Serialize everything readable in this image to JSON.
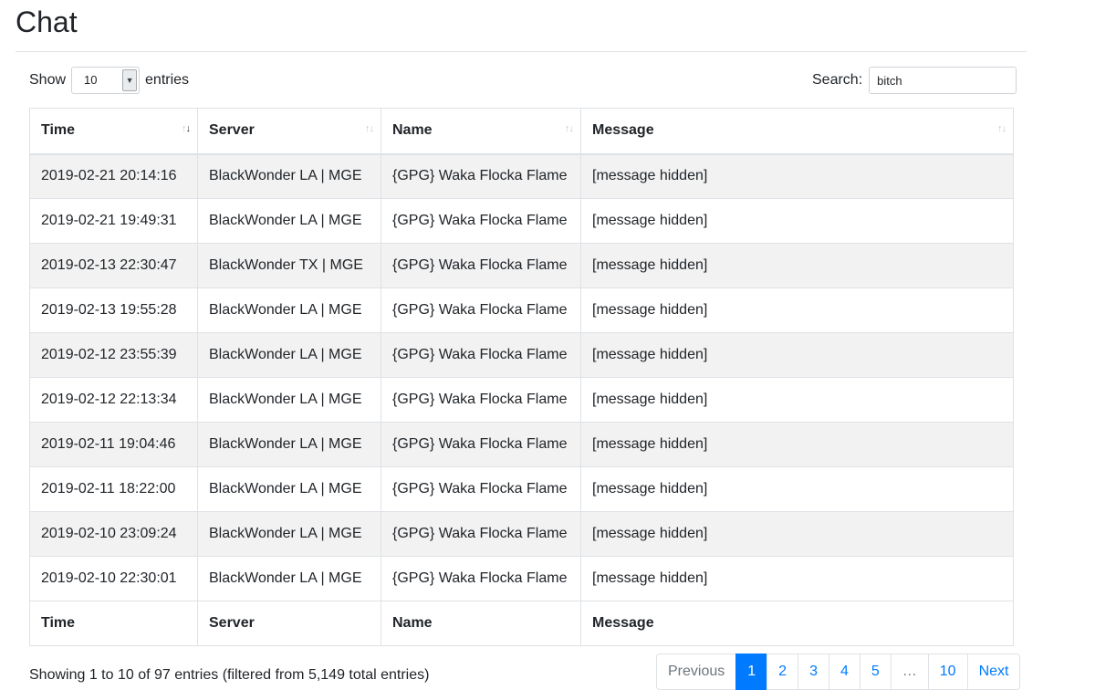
{
  "page": {
    "title": "Chat"
  },
  "controls": {
    "length_prefix": "Show",
    "length_value": "10",
    "length_suffix": "entries",
    "search_label": "Search:",
    "search_value": "bitch"
  },
  "table": {
    "columns": [
      "Time",
      "Server",
      "Name",
      "Message"
    ],
    "rows": [
      [
        "2019-02-21 20:14:16",
        "BlackWonder LA | MGE",
        "{GPG} Waka Flocka Flame",
        "[message hidden]"
      ],
      [
        "2019-02-21 19:49:31",
        "BlackWonder LA | MGE",
        "{GPG} Waka Flocka Flame",
        "[message hidden]"
      ],
      [
        "2019-02-13 22:30:47",
        "BlackWonder TX | MGE",
        "{GPG} Waka Flocka Flame",
        "[message hidden]"
      ],
      [
        "2019-02-13 19:55:28",
        "BlackWonder LA | MGE",
        "{GPG} Waka Flocka Flame",
        "[message hidden]"
      ],
      [
        "2019-02-12 23:55:39",
        "BlackWonder LA | MGE",
        "{GPG} Waka Flocka Flame",
        "[message hidden]"
      ],
      [
        "2019-02-12 22:13:34",
        "BlackWonder LA | MGE",
        "{GPG} Waka Flocka Flame",
        "[message hidden]"
      ],
      [
        "2019-02-11 19:04:46",
        "BlackWonder LA | MGE",
        "{GPG} Waka Flocka Flame",
        "[message hidden]"
      ],
      [
        "2019-02-11 18:22:00",
        "BlackWonder LA | MGE",
        "{GPG} Waka Flocka Flame",
        "[message hidden]"
      ],
      [
        "2019-02-10 23:09:24",
        "BlackWonder LA | MGE",
        "{GPG} Waka Flocka Flame",
        "[message hidden]"
      ],
      [
        "2019-02-10 22:30:01",
        "BlackWonder LA | MGE",
        "{GPG} Waka Flocka Flame",
        "[message hidden]"
      ]
    ]
  },
  "footer": {
    "info": "Showing 1 to 10 of 97 entries (filtered from 5,149 total entries)",
    "pagination": {
      "previous": "Previous",
      "pages": [
        "1",
        "2",
        "3",
        "4",
        "5",
        "…",
        "10"
      ],
      "current": "1",
      "next": "Next"
    }
  },
  "colors": {
    "accent": "#007bff",
    "stripe": "#f2f2f2",
    "border": "#dee2e6",
    "text": "#212529"
  }
}
